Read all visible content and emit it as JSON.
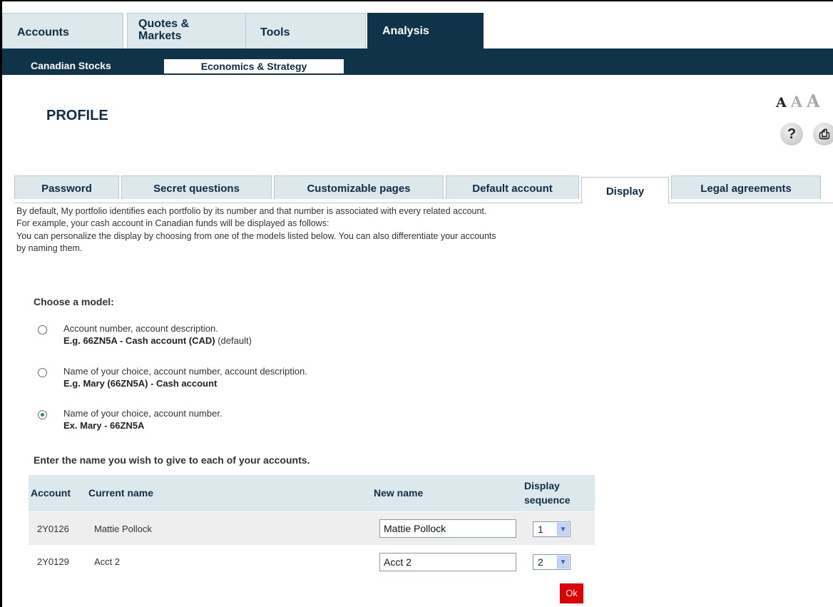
{
  "topnav": {
    "tabs": [
      {
        "label": "Accounts"
      },
      {
        "label": "Quotes &"
      },
      {
        "label": "Tools"
      },
      {
        "label": "Analysis"
      }
    ],
    "tab2_line2": "Markets"
  },
  "subnav": {
    "items": [
      {
        "label": "Canadian Stocks"
      },
      {
        "label": "Economics & Strategy"
      }
    ]
  },
  "page": {
    "title": "PROFILE",
    "font_sizes": [
      "A",
      "A",
      "A"
    ],
    "help_icon_glyph": "?",
    "print_icon_glyph": "⎙"
  },
  "profile_tabs": [
    {
      "label": "Password"
    },
    {
      "label": "Secret questions"
    },
    {
      "label": "Customizable pages"
    },
    {
      "label": "Default account"
    },
    {
      "label": "Display"
    },
    {
      "label": "Legal agreements"
    }
  ],
  "intro": {
    "line1": "By default, My portfolio identifies each portfolio by its number and that number is associated with every related account.",
    "line2": "For example, your cash account in Canadian funds will be displayed as follows:",
    "line3": "You can personalize the display by choosing from one of the models listed below. You can also differentiate your accounts",
    "line4": "by naming them."
  },
  "models": {
    "heading": "Choose a model:",
    "options": [
      {
        "desc": "Account number, account description.",
        "example": "E.g. 66ZN5A - Cash account (CAD)",
        "suffix": " (default)",
        "selected": false
      },
      {
        "desc": "Name of your choice, account number, account description.",
        "example": "E.g. Mary (66ZN5A) - Cash account",
        "suffix": "",
        "selected": false
      },
      {
        "desc": "Name of your choice, account number.",
        "example": "Ex. Mary - 66ZN5A",
        "suffix": "",
        "selected": true
      }
    ]
  },
  "accounts": {
    "heading": "Enter the name you wish to give to each of your accounts.",
    "columns": {
      "account": "Account",
      "current": "Current name",
      "new": "New name",
      "seq1": "Display",
      "seq2": "sequence"
    },
    "rows": [
      {
        "account": "2Y0126",
        "current": "Mattie Pollock",
        "new": "Mattie Pollock",
        "seq": "1"
      },
      {
        "account": "2Y0129",
        "current": "Acct 2",
        "new": "Acct 2",
        "seq": "2"
      }
    ],
    "ok_label": "Ok"
  },
  "colors": {
    "navy": "#0f3349",
    "tab_bg": "#dde8ec",
    "ok_red": "#e00000"
  }
}
